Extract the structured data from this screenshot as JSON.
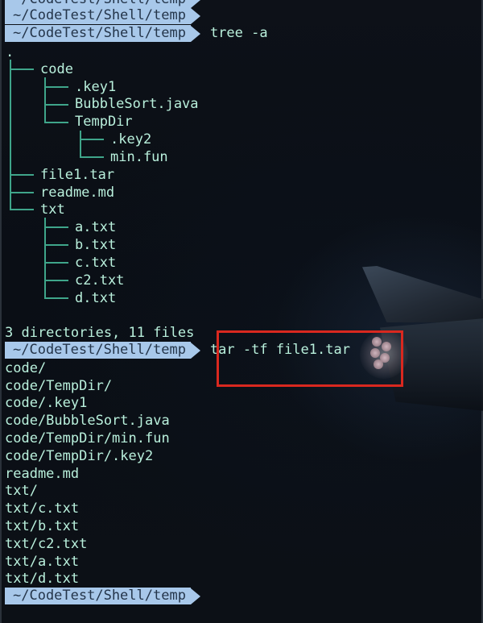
{
  "prompt": {
    "path": "~/CodeTest/Shell/temp"
  },
  "commands": {
    "tree": "tree -a",
    "tar": "tar -tf file1.tar"
  },
  "tree_output": {
    "root": ".",
    "code": "code",
    "key1": ".key1",
    "bubble": "BubbleSort.java",
    "tempdir": "TempDir",
    "key2": ".key2",
    "minfun": "min.fun",
    "file1": "file1.tar",
    "readme": "readme.md",
    "txt": "txt",
    "a": "a.txt",
    "b": "b.txt",
    "c": "c.txt",
    "c2": "c2.txt",
    "d": "d.txt",
    "summary": "3 directories, 11 files"
  },
  "tar_output": [
    "code/",
    "code/TempDir/",
    "code/.key1",
    "code/BubbleSort.java",
    "code/TempDir/min.fun",
    "code/TempDir/.key2",
    "readme.md",
    "txt/",
    "txt/c.txt",
    "txt/b.txt",
    "txt/c2.txt",
    "txt/a.txt",
    "txt/d.txt"
  ],
  "colors": {
    "background": "#0b0f16",
    "text": "#b9f0dc",
    "prompt_bg": "#a8c8ea",
    "prompt_text": "#24354a",
    "tree_lines": "#3fa58a",
    "highlight": "#d9281f"
  }
}
